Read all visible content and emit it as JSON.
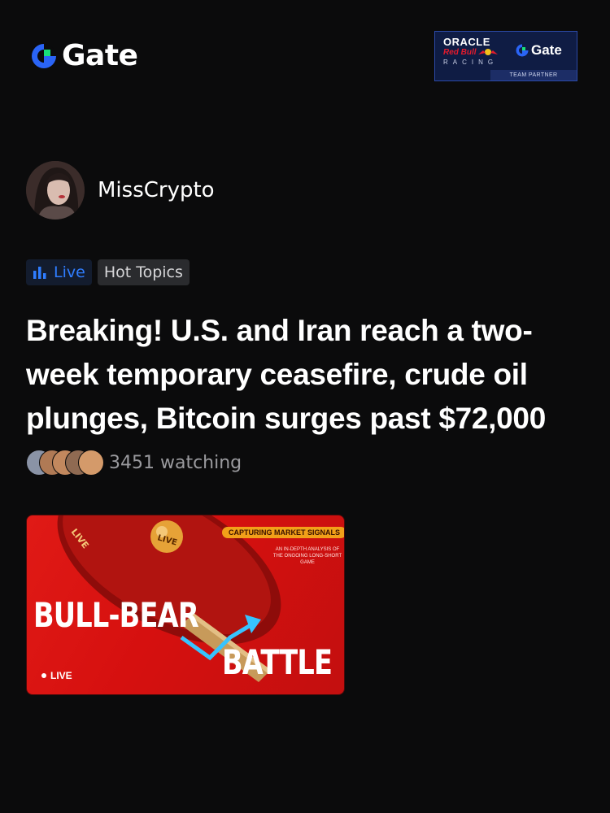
{
  "header": {
    "brand": "Gate",
    "partner_badge": {
      "oracle": "ORACLE",
      "redbull": "Red Bull",
      "racing": "RACING",
      "gate": "Gate",
      "team_partner": "TEAM PARTNER"
    }
  },
  "author": {
    "name": "MissCrypto"
  },
  "tags": {
    "live": "Live",
    "hot_topics": "Hot Topics"
  },
  "headline": "Breaking! U.S. and Iran reach a two-week temporary ceasefire, crude oil plunges, Bitcoin surges past $72,000",
  "watchers": {
    "count_text": "3451 watching",
    "avatar_colors": [
      "#8a93a6",
      "#b07a55",
      "#c2885e",
      "#8f6a52",
      "#d49a6a"
    ]
  },
  "live_card": {
    "pill": "CAPTURING MARKET SIGNALS",
    "subtitle": "AN IN-DEPTH ANALYSIS OF THE ONGOING LONG-SHORT GAME",
    "title_line1": "BULL-BEAR",
    "title_line2": "BATTLE",
    "badge": "LIVE",
    "paddle_text": "LIVE",
    "ball_text": "LIVE"
  },
  "colors": {
    "background": "#0b0b0c",
    "accent_blue": "#2f7dff",
    "brand_green": "#18e07a",
    "card_red": "#d6100f"
  }
}
